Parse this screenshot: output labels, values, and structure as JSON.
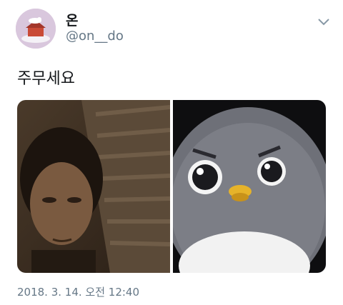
{
  "tweet": {
    "display_name": "온",
    "handle": "@on__do",
    "text": "주무세요",
    "timestamp": "2018. 3. 14. 오전 12:40"
  },
  "icons": {
    "menu": "chevron-down-icon"
  },
  "colors": {
    "text_primary": "#14171a",
    "text_secondary": "#657786",
    "avatar_bg": "#d9c7dd"
  }
}
